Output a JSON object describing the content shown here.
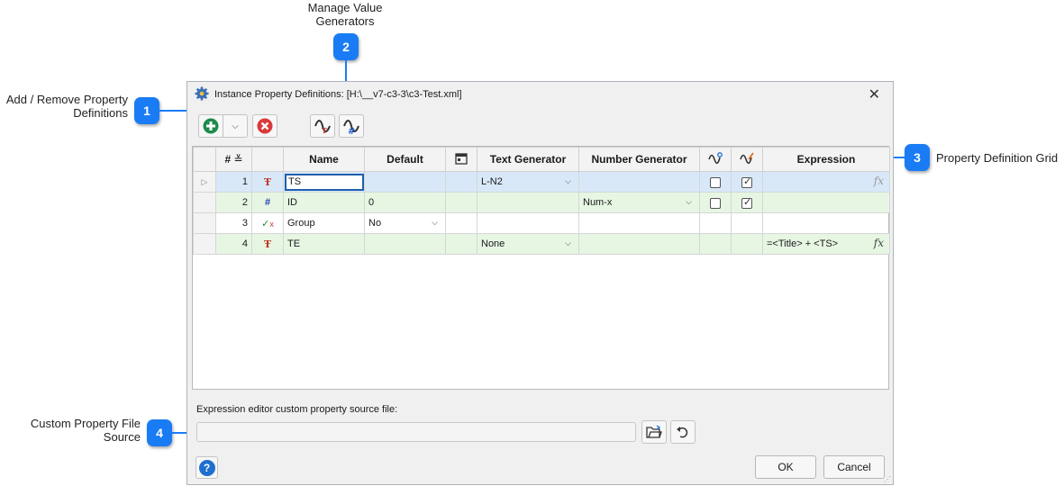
{
  "callouts": [
    {
      "num": "1",
      "text_line1": "Add / Remove Property",
      "text_line2": "Definitions"
    },
    {
      "num": "2",
      "text_line1": "Manage Value",
      "text_line2": "Generators"
    },
    {
      "num": "3",
      "text": "Property Definition Grid"
    },
    {
      "num": "4",
      "text_line1": "Custom Property File",
      "text_line2": "Source"
    }
  ],
  "dialog": {
    "title": "Instance Property Definitions: [H:\\__v7-c3-3\\c3-Test.xml]",
    "close_glyph": "✕"
  },
  "grid": {
    "columns": [
      "#",
      "",
      "Name",
      "Default",
      "",
      "Text Generator",
      "Number Generator",
      "",
      "",
      "Expression"
    ],
    "rows": [
      {
        "num": "1",
        "type": "text",
        "name": "TS",
        "default": "",
        "text_gen": "L-N2",
        "num_gen": "",
        "check1": false,
        "check2": true,
        "expression": ""
      },
      {
        "num": "2",
        "type": "number",
        "name": "ID",
        "default": "0",
        "text_gen": "",
        "num_gen": "Num-x",
        "check1": false,
        "check2": true,
        "expression": ""
      },
      {
        "num": "3",
        "type": "boolean",
        "name": "Group",
        "default": "No",
        "text_gen": "",
        "num_gen": "",
        "expression": ""
      },
      {
        "num": "4",
        "type": "text",
        "name": "TE",
        "default": "",
        "text_gen": "None",
        "num_gen": "",
        "expression": "=<Title> + <TS>"
      }
    ]
  },
  "source": {
    "label": "Expression editor custom property source file:",
    "value": ""
  },
  "buttons": {
    "ok": "OK",
    "cancel": "Cancel",
    "help": "?"
  },
  "colors": {
    "accent": "#1a7cf5",
    "selected_row": "#d8e8f8",
    "alt_row": "#e6f6e3"
  }
}
